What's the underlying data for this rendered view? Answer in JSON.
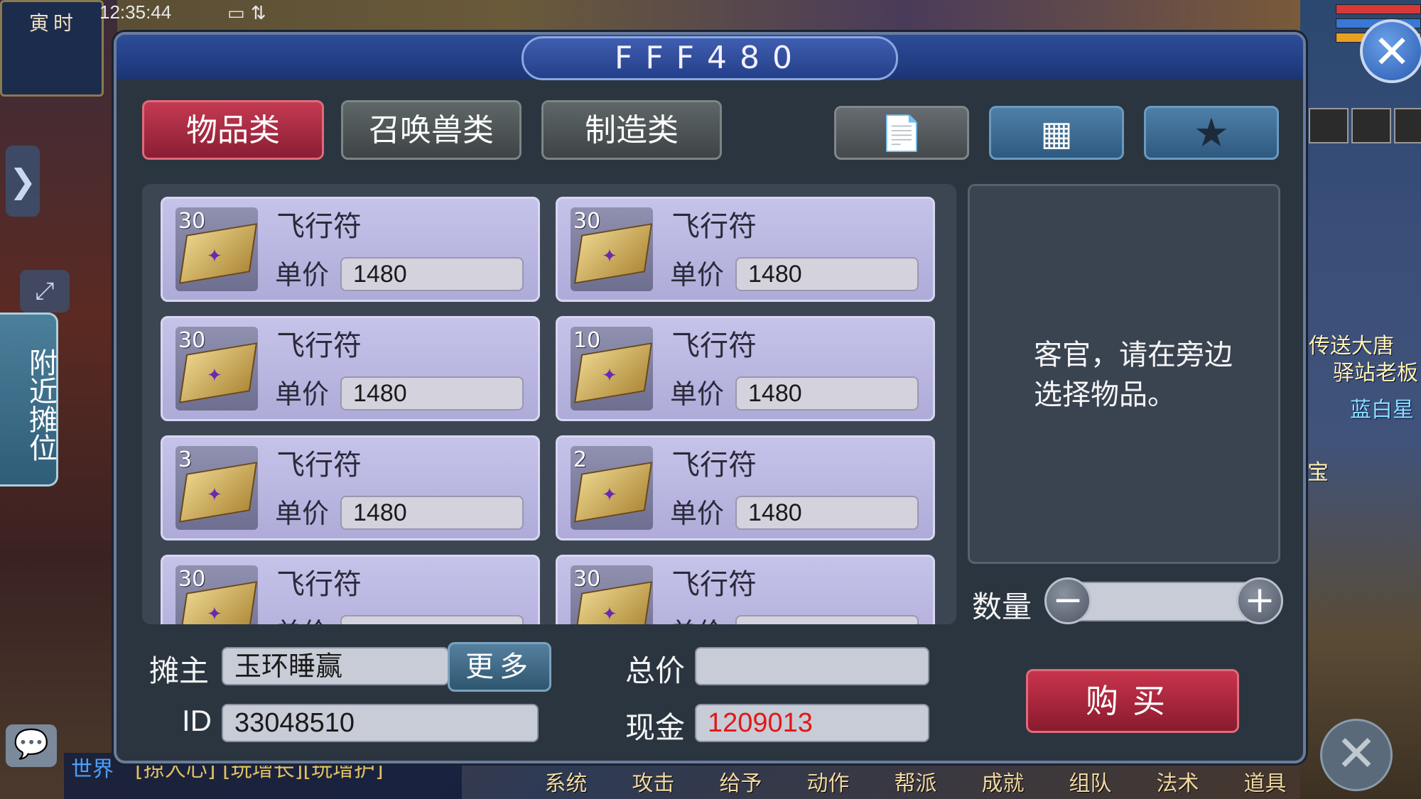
{
  "hud": {
    "clock_label": "寅时",
    "status_time": "12:35:44",
    "status_icons": "▭ ⇅",
    "side_arrow": "❯",
    "expand_icon": "⤢",
    "nearby_stalls": "附近摊位",
    "right_tags": [
      "传送大唐",
      "驿站老板",
      "蓝白星",
      "宝"
    ],
    "chat_icon": "💬",
    "chat_channel": "世界",
    "chat_text": "[掠人心] [玩增长][玩增护]",
    "bottom_menu": [
      "系统",
      "攻击",
      "给予",
      "动作",
      "帮派",
      "成就",
      "组队",
      "法术",
      "道具"
    ],
    "corner_close": "✕"
  },
  "dialog": {
    "title": "FFF480",
    "close": "✕",
    "tabs": [
      "物品类",
      "召唤兽类",
      "制造类"
    ],
    "icon_buttons": {
      "record": "📄",
      "grid": "▦",
      "favorite": "★"
    }
  },
  "items": [
    {
      "qty": "30",
      "name": "飞行符",
      "price_label": "单价",
      "price": "1480"
    },
    {
      "qty": "30",
      "name": "飞行符",
      "price_label": "单价",
      "price": "1480"
    },
    {
      "qty": "30",
      "name": "飞行符",
      "price_label": "单价",
      "price": "1480"
    },
    {
      "qty": "10",
      "name": "飞行符",
      "price_label": "单价",
      "price": "1480"
    },
    {
      "qty": "3",
      "name": "飞行符",
      "price_label": "单价",
      "price": "1480"
    },
    {
      "qty": "2",
      "name": "飞行符",
      "price_label": "单价",
      "price": "1480"
    },
    {
      "qty": "30",
      "name": "飞行符",
      "price_label": "单价",
      "price": ""
    },
    {
      "qty": "30",
      "name": "飞行符",
      "price_label": "单价",
      "price": ""
    }
  ],
  "info": {
    "message": "客官，请在旁边选择物品。"
  },
  "quantity": {
    "label": "数量",
    "minus": "−",
    "plus": "+",
    "value": ""
  },
  "seller": {
    "owner_label": "摊主",
    "owner_name": "玉环睡赢",
    "more_label": "更多",
    "id_label": "ID",
    "id_value": "33048510"
  },
  "totals": {
    "total_label": "总价",
    "total_value": "",
    "cash_label": "现金",
    "cash_value": "1209013"
  },
  "buy_label": "购买",
  "colors": {
    "cash": "#e01818",
    "active_tab": "#b02a44",
    "buy": "#b02238"
  }
}
